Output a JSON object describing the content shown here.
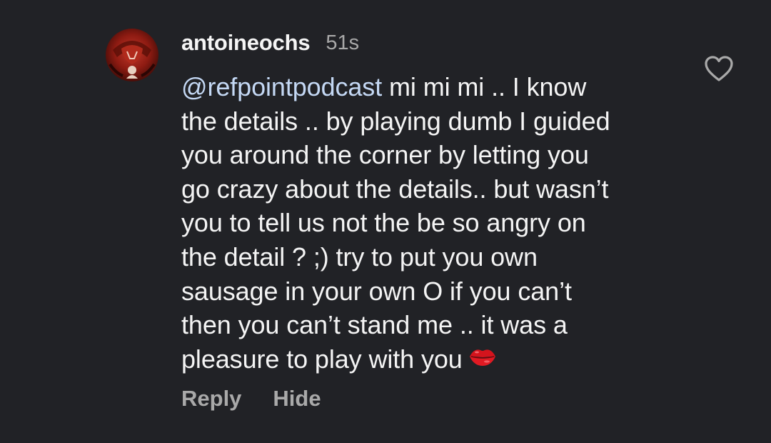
{
  "comment": {
    "username": "antoineochs",
    "timestamp": "51s",
    "avatar_icon": "profile-avatar",
    "mention": "@refpointpodcast",
    "lines": [
      " mi mi mi .. I know",
      "the details .. by playing dumb I guided",
      "you around the corner by letting you",
      "go crazy about the details.. but wasn’t",
      "you to tell us not the be so angry on",
      "the detail ? ;) try to put you own",
      "sausage in your own O if you can’t",
      "then you can’t stand me .. it was a",
      "pleasure to play with you"
    ],
    "emoji": "kiss-mark-emoji",
    "like_icon": "heart-outline-icon",
    "actions": {
      "reply": "Reply",
      "hide": "Hide"
    }
  },
  "colors": {
    "background": "#212226",
    "text": "#f4f4f4",
    "mention": "#c4d8f4",
    "muted": "#a9a9a9",
    "emoji_red": "#d4141d"
  }
}
